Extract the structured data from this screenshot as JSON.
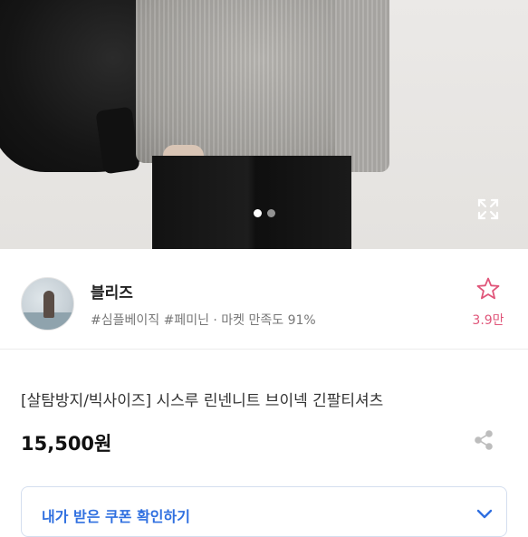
{
  "product_image": {
    "slide_count": 2,
    "active_slide": 1,
    "expand_icon": "expand-icon"
  },
  "seller": {
    "name": "블리즈",
    "tags": "#심플베이직 #페미닌 · 마켓 만족도 91%",
    "like_count": "3.9만",
    "like_icon": "star-outline-icon"
  },
  "product": {
    "title": "[살탐방지/빅사이즈] 시스루 린넨니트 브이넥 긴팔티셔츠",
    "price": "15,500원",
    "share_icon": "share-icon"
  },
  "coupon": {
    "label": "내가 받은 쿠폰 확인하기",
    "icon": "chevron-down-icon"
  },
  "colors": {
    "accent_pink": "#e0567a",
    "accent_blue": "#2f6fe0"
  }
}
